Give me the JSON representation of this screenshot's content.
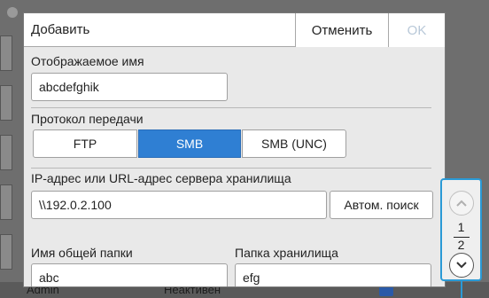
{
  "background": {
    "status_user": "Admin",
    "status_state": "Неактивен"
  },
  "dialog": {
    "title": "Добавить",
    "cancel_label": "Отменить",
    "ok_label": "OK",
    "display_name": {
      "label": "Отображаемое имя",
      "value": "abcdefghik"
    },
    "protocol": {
      "label": "Протокол передачи",
      "options": [
        "FTP",
        "SMB",
        "SMB (UNC)"
      ],
      "selected": "SMB"
    },
    "server_address": {
      "label": "IP-адрес или URL-адрес сервера хранилища",
      "value": "\\\\192.0.2.100",
      "auto_search_label": "Автом. поиск"
    },
    "shared_folder": {
      "label": "Имя общей папки",
      "value": "abc"
    },
    "storage_folder": {
      "label": "Папка хранилища",
      "value": "efg"
    }
  },
  "pager": {
    "current_page": "1",
    "total_pages": "2",
    "up_icon": "chevron-up-icon",
    "down_icon": "chevron-down-icon"
  },
  "colors": {
    "accent": "#2f7fd3",
    "highlight": "#2a9ad6",
    "ok_disabled": "#b8c8d8"
  }
}
